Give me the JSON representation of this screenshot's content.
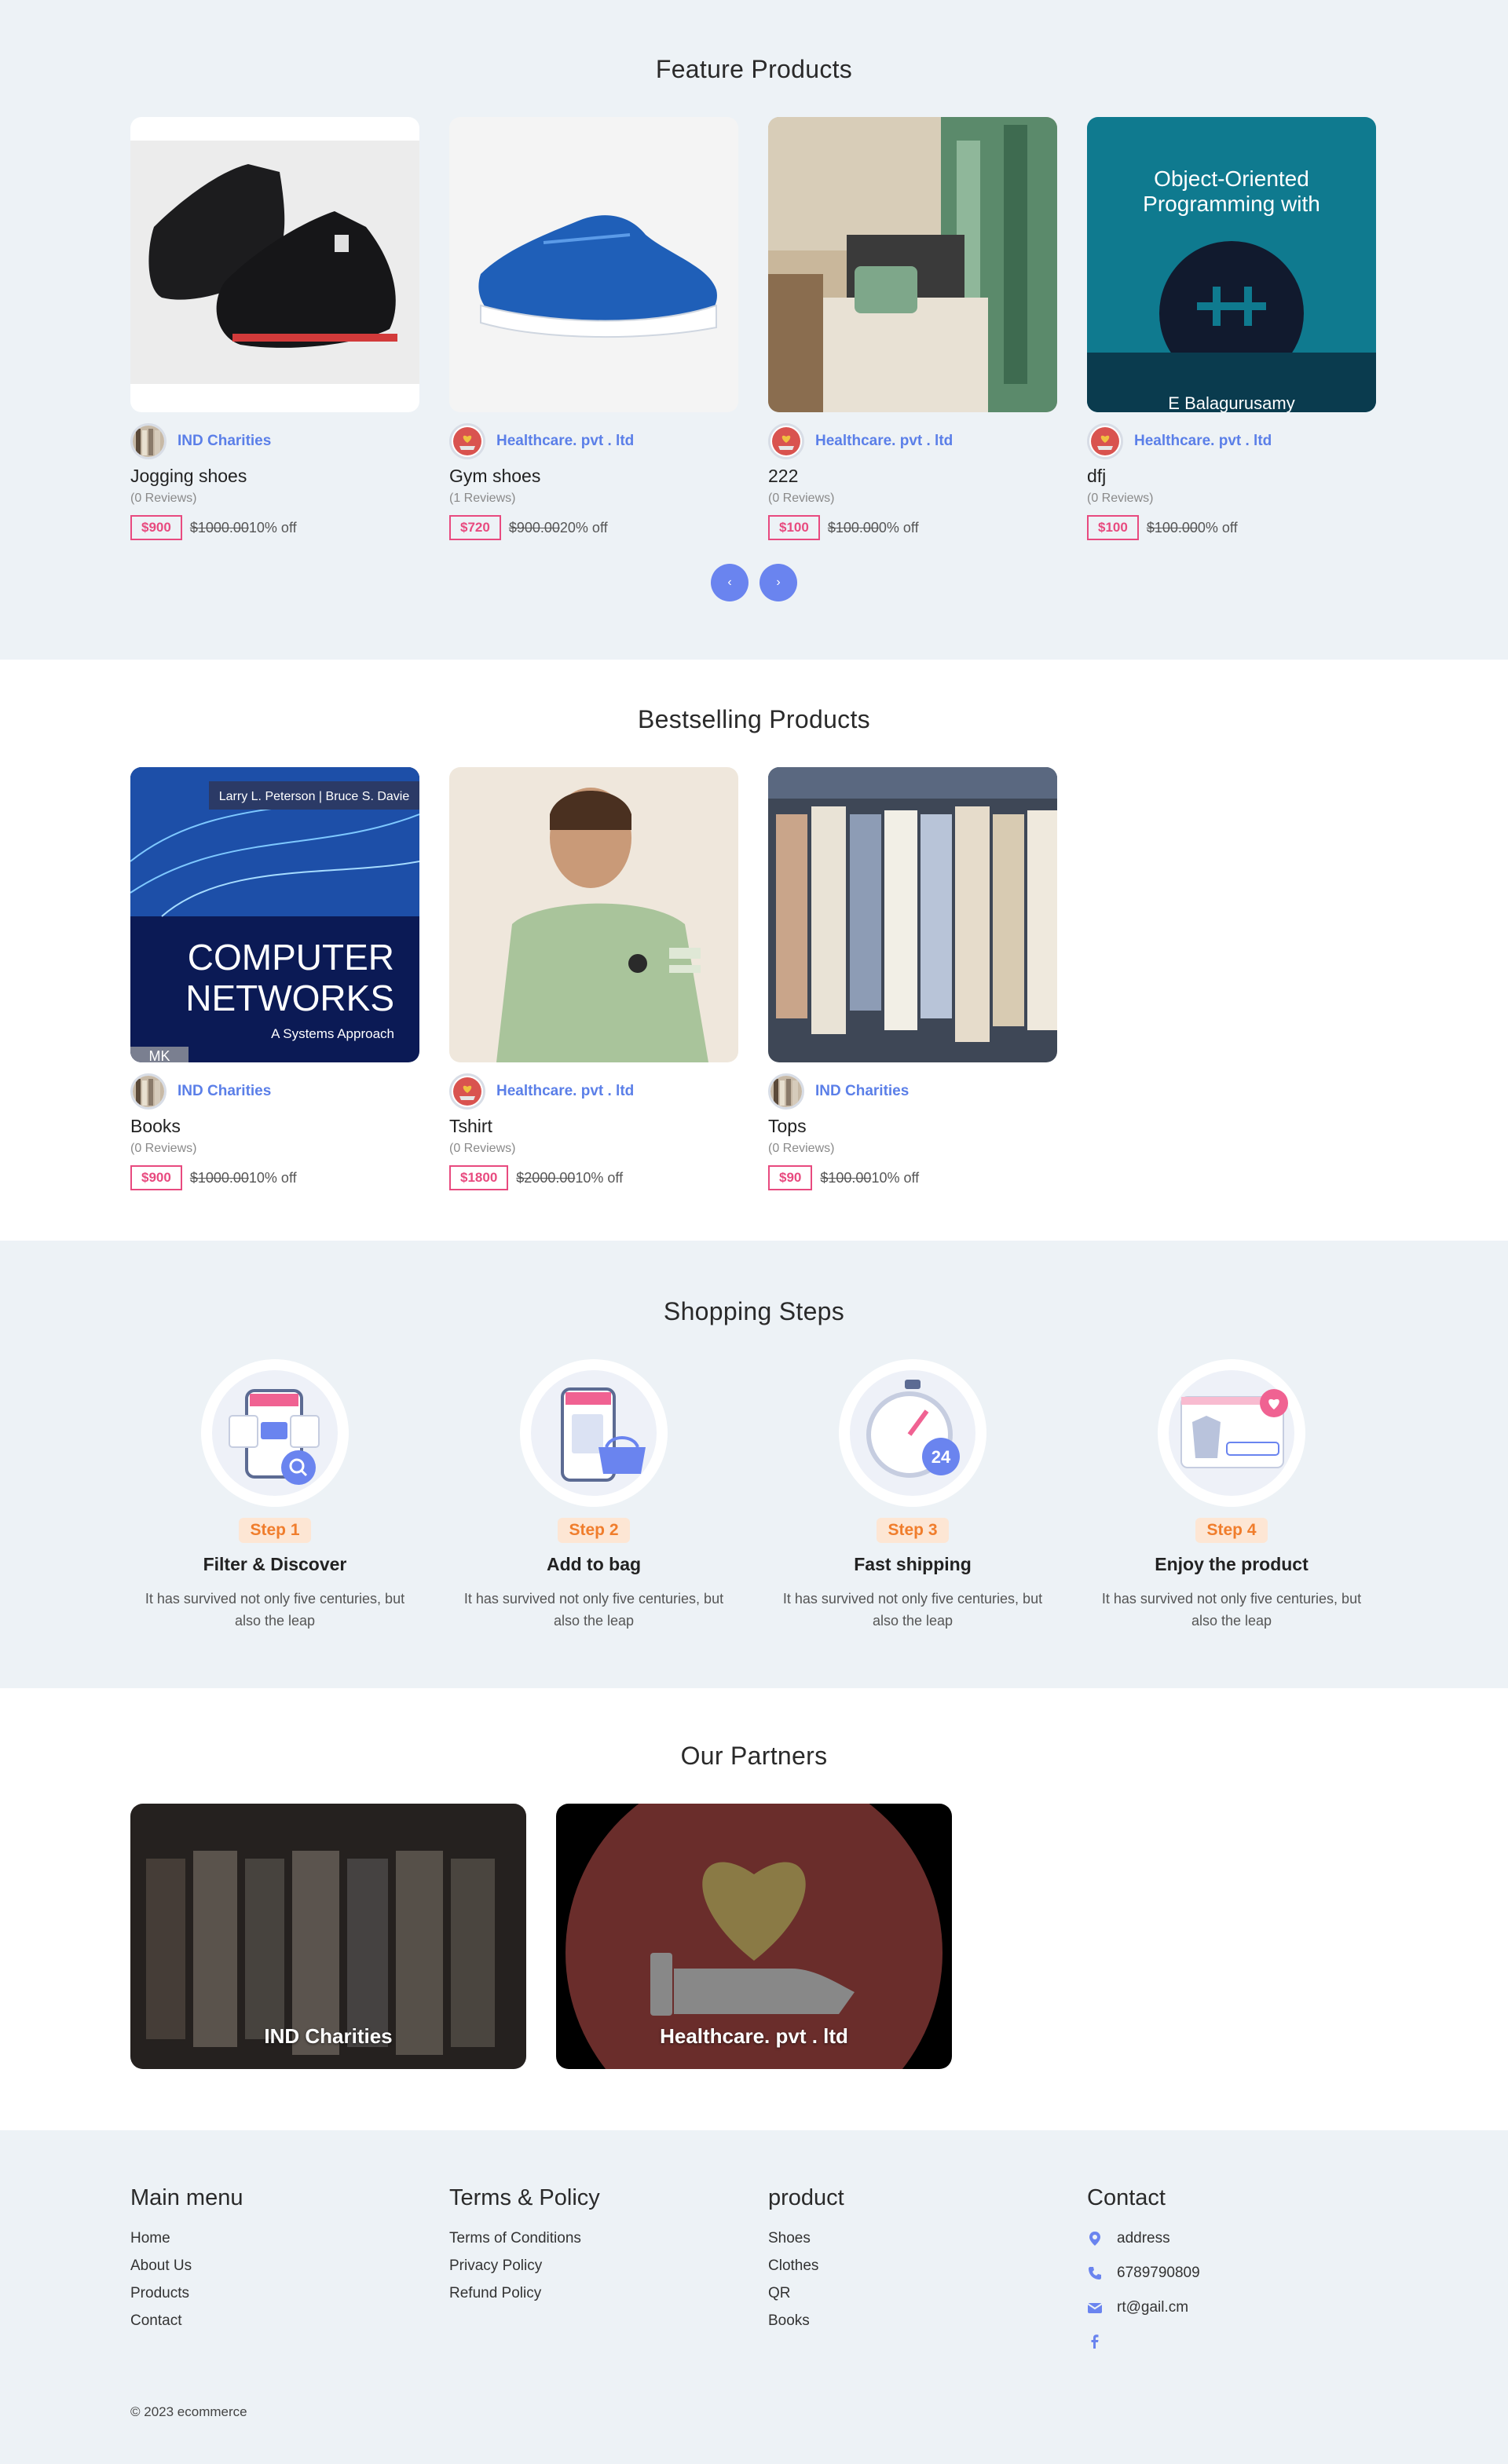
{
  "featured": {
    "title": "Feature Products",
    "products": [
      {
        "seller": "IND Charities",
        "name": "Jogging shoes",
        "reviews": "(0 Reviews)",
        "price": "$900",
        "old_price": "$1000.00",
        "off": "10% off"
      },
      {
        "seller": "Healthcare. pvt . ltd",
        "name": "Gym shoes",
        "reviews": "(1 Reviews)",
        "price": "$720",
        "old_price": "$900.00",
        "off": "20% off"
      },
      {
        "seller": "Healthcare. pvt . ltd",
        "name": "222",
        "reviews": "(0 Reviews)",
        "price": "$100",
        "old_price": "$100.00",
        "off": "0% off"
      },
      {
        "seller": "Healthcare. pvt . ltd",
        "name": "dfj",
        "reviews": "(0 Reviews)",
        "price": "$100",
        "old_price": "$100.00",
        "off": "0% off",
        "cover_title_1": "Object-Oriented",
        "cover_title_2": "Programming with",
        "cover_author": "E Balagurusamy"
      }
    ],
    "prev_label": "‹",
    "next_label": "›"
  },
  "bestselling": {
    "title": "Bestselling Products",
    "products": [
      {
        "seller": "IND Charities",
        "name": "Books",
        "reviews": "(0 Reviews)",
        "price": "$900",
        "old_price": "$1000.00",
        "off": "10% off",
        "cover_authors": "Larry L. Peterson | Bruce S. Davie",
        "cover_title_1": "COMPUTER",
        "cover_title_2": "NETWORKS",
        "cover_subtitle": "A Systems Approach",
        "cover_publisher": "MK"
      },
      {
        "seller": "Healthcare. pvt . ltd",
        "name": "Tshirt",
        "reviews": "(0 Reviews)",
        "price": "$1800",
        "old_price": "$2000.00",
        "off": "10% off"
      },
      {
        "seller": "IND Charities",
        "name": "Tops",
        "reviews": "(0 Reviews)",
        "price": "$90",
        "old_price": "$100.00",
        "off": "10% off"
      }
    ]
  },
  "steps": {
    "title": "Shopping Steps",
    "items": [
      {
        "badge": "Step 1",
        "title": "Filter & Discover",
        "desc": "It has survived not only five centuries, but also the leap"
      },
      {
        "badge": "Step 2",
        "title": "Add to bag",
        "desc": "It has survived not only five centuries, but also the leap"
      },
      {
        "badge": "Step 3",
        "title": "Fast shipping",
        "desc": "It has survived not only five centuries, but also the leap",
        "timer": "24"
      },
      {
        "badge": "Step 4",
        "title": "Enjoy the product",
        "desc": "It has survived not only five centuries, but also the leap"
      }
    ]
  },
  "partners": {
    "title": "Our Partners",
    "items": [
      {
        "name": "IND Charities"
      },
      {
        "name": "Healthcare. pvt . ltd"
      }
    ]
  },
  "footer": {
    "main_menu": {
      "title": "Main menu",
      "links": [
        "Home",
        "About Us",
        "Products",
        "Contact"
      ]
    },
    "terms": {
      "title": "Terms & Policy",
      "links": [
        "Terms of Conditions",
        "Privacy Policy",
        "Refund Policy"
      ]
    },
    "product": {
      "title": "product",
      "links": [
        "Shoes",
        "Clothes",
        "QR",
        "Books"
      ]
    },
    "contact": {
      "title": "Contact",
      "address": "address",
      "phone": "6789790809",
      "email": "rt@gail.cm"
    },
    "copyright": "© 2023 ecommerce"
  },
  "colors": {
    "accent": "#6a84ef",
    "price": "#e84a7f",
    "step": "#f07d2c",
    "bg_light": "#edf2f6"
  }
}
